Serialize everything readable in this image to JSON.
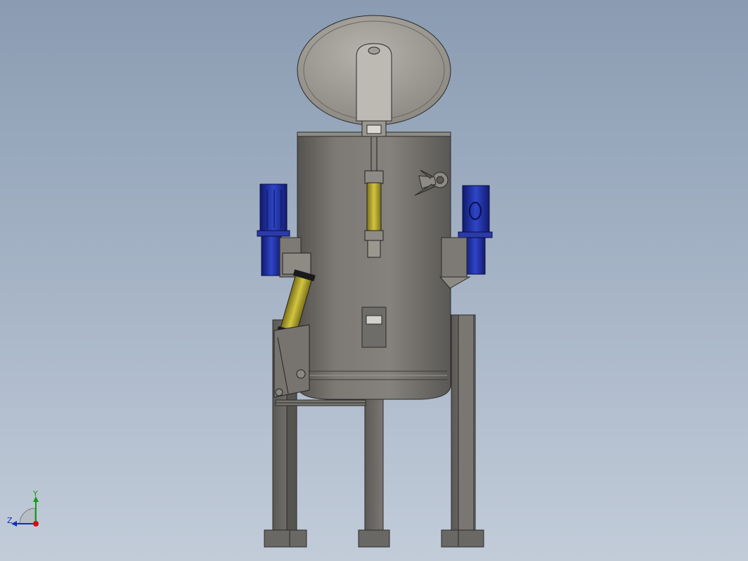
{
  "triad": {
    "x_label": "",
    "y_label": "Y",
    "z_label": "Z"
  },
  "colors": {
    "background_top": "#8a9cb2",
    "background_bottom": "#c2ccd9",
    "steel": "#6d6b67",
    "motor_blue": "#1f2f9e",
    "cylinder_yellow": "#b9ad2a",
    "axis_x": "#d01010",
    "axis_y": "#10a010",
    "axis_z": "#1030c0"
  },
  "icons": [
    "triad-icon"
  ]
}
